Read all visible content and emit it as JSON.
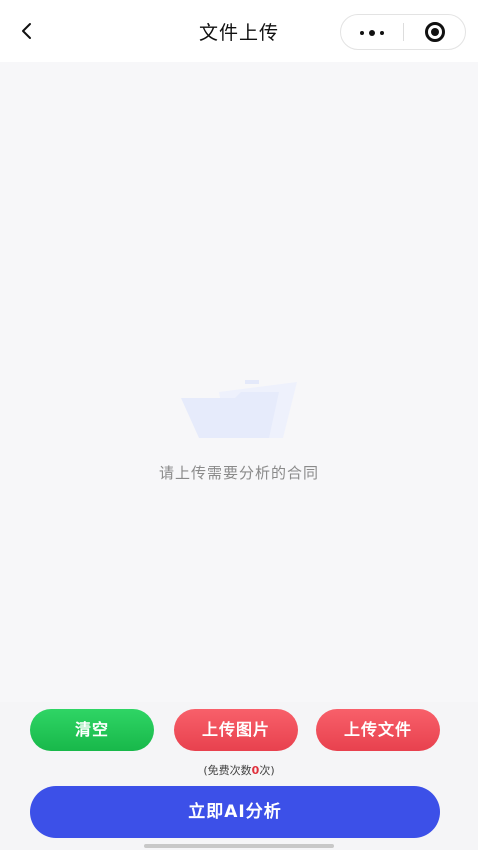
{
  "navbar": {
    "title": "文件上传",
    "back_icon": "chevron-left-icon",
    "more_icon": "more-dots-icon",
    "close_icon": "target-icon"
  },
  "empty_state": {
    "icon": "folder-icon",
    "text": "请上传需要分析的合同",
    "icon_color": "#e6ebfb"
  },
  "actions": {
    "clear_label": "清空",
    "upload_image_label": "上传图片",
    "upload_file_label": "上传文件"
  },
  "free_note": {
    "prefix": "(免费次数",
    "count": "0",
    "suffix": "次)"
  },
  "analyze_button": {
    "label": "立即AI分析"
  },
  "colors": {
    "clear": "#22c55a",
    "upload": "#ef4f5a",
    "analyze": "#3c50e8"
  }
}
